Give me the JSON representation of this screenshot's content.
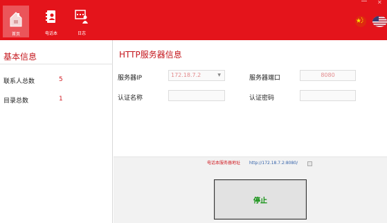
{
  "nav": {
    "home_label": "首页",
    "phonebook_label": "电话本",
    "log_label": "日志"
  },
  "icons": {
    "home": "house-icon",
    "phonebook": "contact-book-icon",
    "log": "log-user-icon",
    "lang_cn": "china-flag-icon",
    "lang_us": "us-flag-icon"
  },
  "colors": {
    "accent": "#e4141b",
    "value_red": "#d01b22",
    "stop_text": "#109010",
    "link": "#2f5fa8"
  },
  "basic_info": {
    "title": "基本信息",
    "contacts_label": "联系人总数",
    "contacts_value": "5",
    "directories_label": "目录总数",
    "directories_value": "1"
  },
  "http": {
    "title": "HTTP服务器信息",
    "ip_label": "服务器IP",
    "ip_value": "172.18.7.2",
    "port_label": "服务器端口",
    "port_value": "8080",
    "auth_name_label": "认证名称",
    "auth_name_value": "",
    "auth_pass_label": "认证密码",
    "auth_pass_value": ""
  },
  "footer": {
    "url_label": "电话本服务器地址",
    "url_value": "http://172.18.7.2:8080/",
    "stop_label": "停止"
  }
}
